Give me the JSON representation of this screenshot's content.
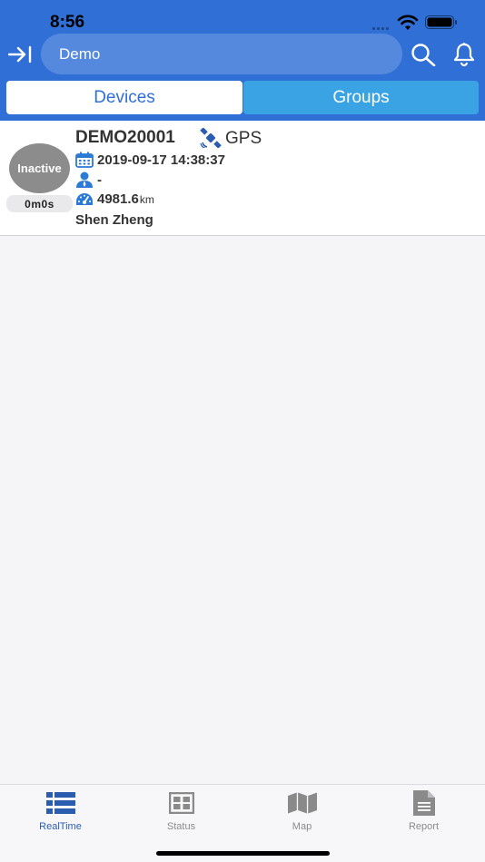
{
  "status_bar": {
    "time": "8:56"
  },
  "header": {
    "search_text": "Demo",
    "tabs": {
      "devices": "Devices",
      "groups": "Groups"
    }
  },
  "device": {
    "status": "Inactive",
    "duration": "0m0s",
    "name": "DEMO20001",
    "source": "GPS",
    "datetime": "2019-09-17 14:38:37",
    "driver": "-",
    "mileage": "4981.6",
    "mileage_unit": "km",
    "location": "Shen Zheng"
  },
  "tabbar": {
    "items": [
      {
        "label": "RealTime",
        "icon": "list-icon",
        "active": true
      },
      {
        "label": "Status",
        "icon": "grid-icon",
        "active": false
      },
      {
        "label": "Map",
        "icon": "map-icon",
        "active": false
      },
      {
        "label": "Report",
        "icon": "report-icon",
        "active": false
      }
    ]
  },
  "colors": {
    "header_bg": "#2f6fd6",
    "segment_active_text": "#2f6fd6",
    "segment_inactive_bg": "#3aa3e3",
    "status_inactive": "#8c8c8c",
    "tab_active": "#2a5db0",
    "tab_inactive": "#8a8a8a"
  }
}
